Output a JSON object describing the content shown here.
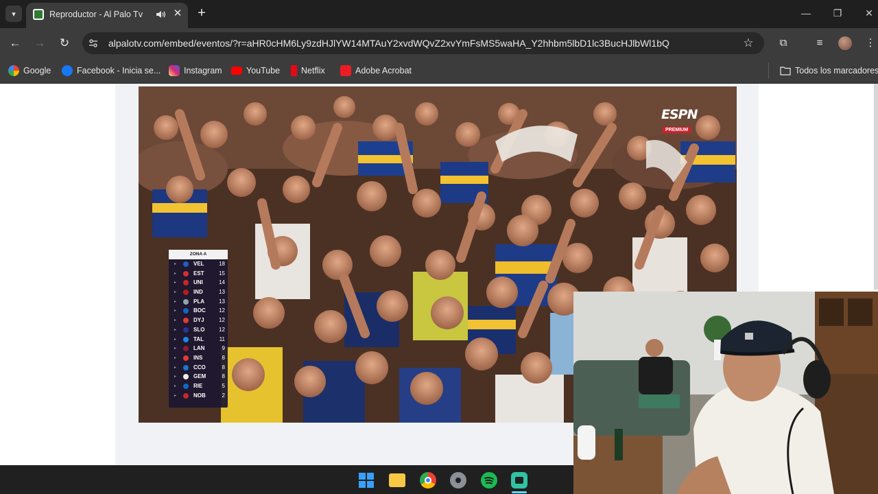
{
  "browser": {
    "tab": {
      "title": "Reproductor - Al Palo Tv"
    },
    "url": "alpalotv.com/embed/eventos/?r=aHR0cHM6Ly9zdHJlYW14MTAuY2xvdWQvZ2xvYmFsMS5waHA_Y2hhbm5lbD1lc3BucHJlbWl1bQ",
    "bookmarks": [
      {
        "label": "Google",
        "color": "#4285f4",
        "icon": "google-icon"
      },
      {
        "label": "Facebook - Inicia se...",
        "color": "#1877f2",
        "icon": "facebook-icon"
      },
      {
        "label": "Instagram",
        "color": "#d62976",
        "icon": "instagram-icon"
      },
      {
        "label": "YouTube",
        "color": "#ff0000",
        "icon": "youtube-icon"
      },
      {
        "label": "Netflix",
        "color": "#e50914",
        "icon": "netflix-icon"
      },
      {
        "label": "Adobe Acrobat",
        "color": "#ec1c24",
        "icon": "acrobat-icon"
      }
    ],
    "all_bookmarks_label": "Todos los marcadores"
  },
  "video": {
    "broadcaster": "ESPN",
    "broadcaster_sub": "PREMIUM",
    "standings": {
      "title": "ZONA A",
      "rows": [
        {
          "team": "VEL",
          "pts": "18",
          "color": "#1f5fbf"
        },
        {
          "team": "EST",
          "pts": "15",
          "color": "#d32f2f"
        },
        {
          "team": "UNI",
          "pts": "14",
          "color": "#c62828"
        },
        {
          "team": "IND",
          "pts": "13",
          "color": "#b71c1c"
        },
        {
          "team": "PLA",
          "pts": "13",
          "color": "#90a4ae"
        },
        {
          "team": "BOC",
          "pts": "12",
          "color": "#1565c0"
        },
        {
          "team": "DYJ",
          "pts": "12",
          "color": "#e53935"
        },
        {
          "team": "SLO",
          "pts": "12",
          "color": "#283593"
        },
        {
          "team": "TAL",
          "pts": "11",
          "color": "#1e88e5"
        },
        {
          "team": "LAN",
          "pts": "9",
          "color": "#8e1b3a"
        },
        {
          "team": "INS",
          "pts": "8",
          "color": "#e53935"
        },
        {
          "team": "CCO",
          "pts": "8",
          "color": "#1976d2"
        },
        {
          "team": "GEM",
          "pts": "8",
          "color": "#eeeeee"
        },
        {
          "team": "RIE",
          "pts": "5",
          "color": "#1565c0"
        },
        {
          "team": "NOB",
          "pts": "2",
          "color": "#c62828"
        }
      ]
    }
  },
  "taskbar": {
    "apps": [
      {
        "name": "start-icon",
        "color": "#1e90ff"
      },
      {
        "name": "file-explorer-icon",
        "color": "#f7c843"
      },
      {
        "name": "chrome-icon",
        "color": "#34a853"
      },
      {
        "name": "settings-icon",
        "color": "#8a8f98"
      },
      {
        "name": "spotify-icon",
        "color": "#1db954"
      },
      {
        "name": "streamlabs-icon",
        "color": "#31c3a2"
      }
    ]
  }
}
